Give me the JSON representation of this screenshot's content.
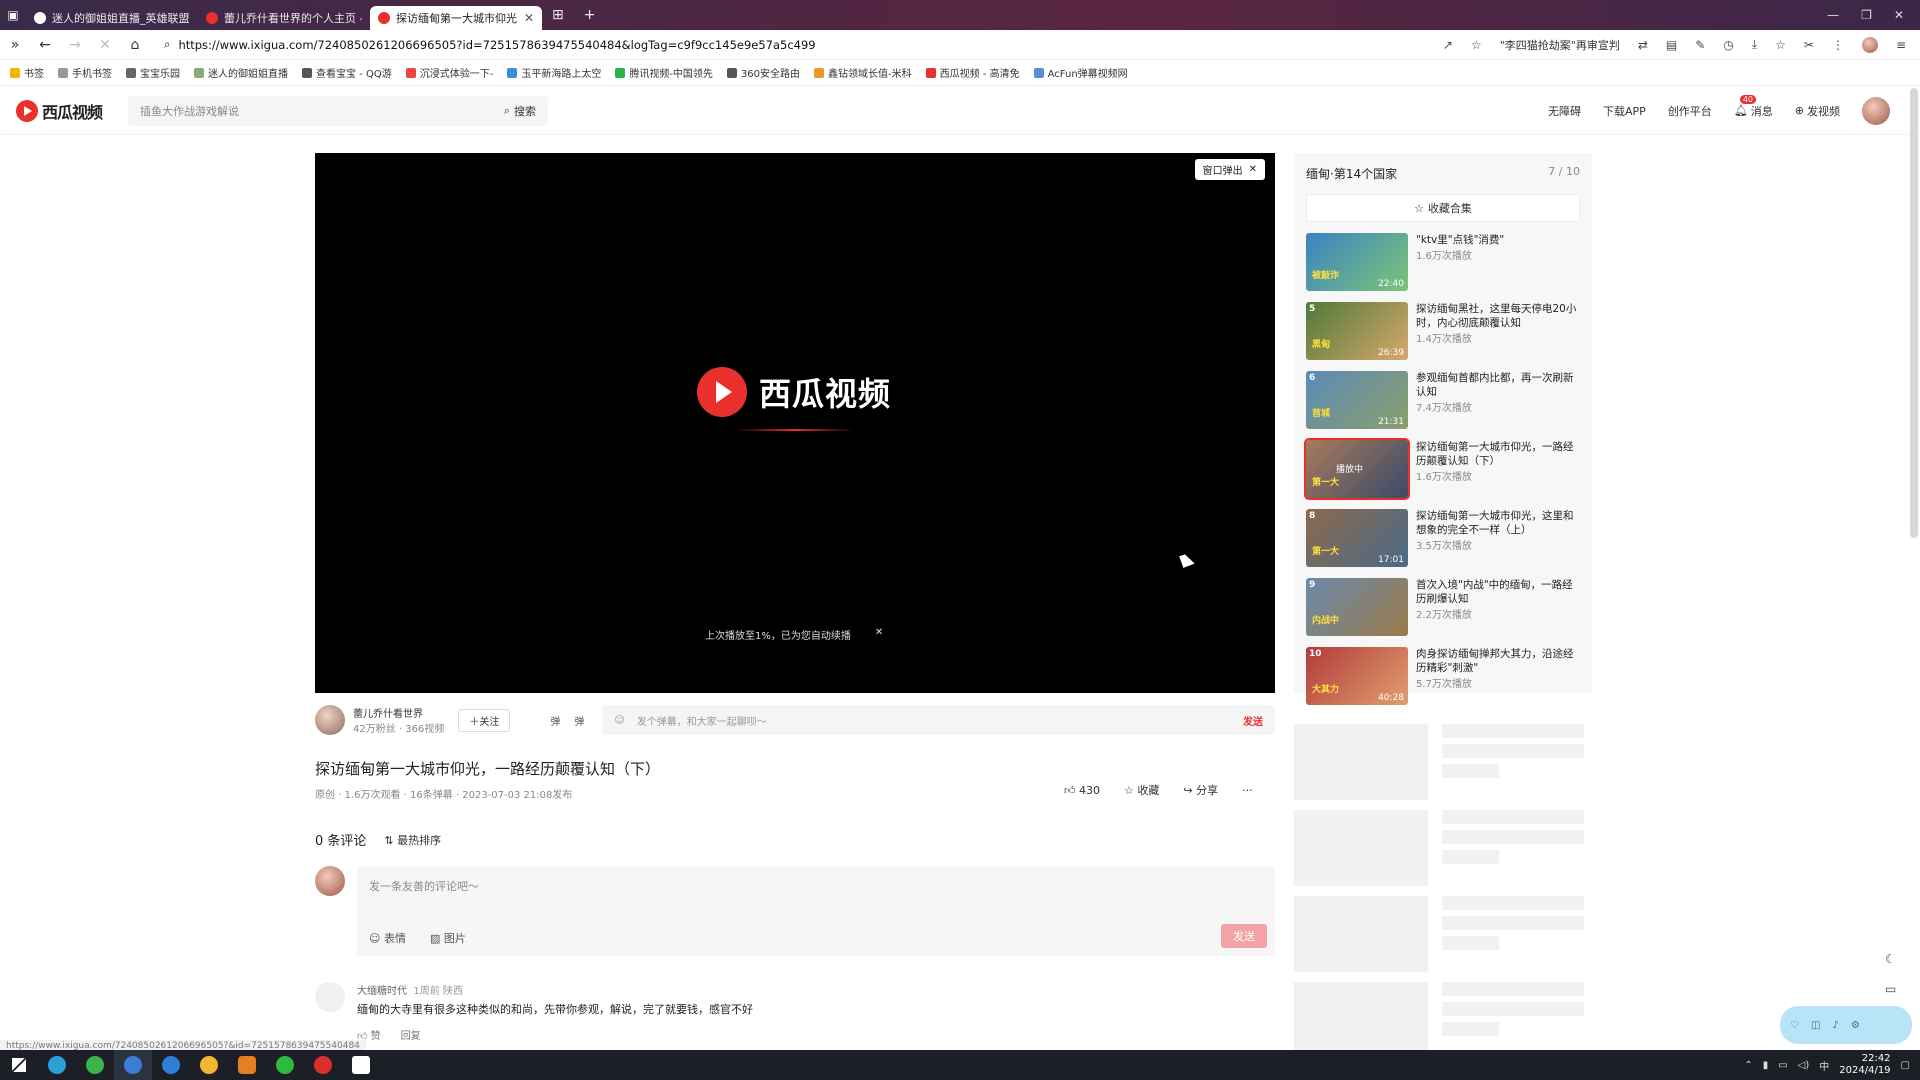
{
  "browser": {
    "tabs": [
      {
        "label": "迷人的御姐姐直播_英雄联盟直播",
        "color": "#ffffff"
      },
      {
        "label": "蕾儿乔什看世界的个人主页 - 西瓜",
        "color": "#e9302d"
      },
      {
        "label": "探访缅甸第一大城市仰光，一路",
        "color": "#e9302d",
        "active": true
      }
    ],
    "url": "https://www.ixigua.com/7240850261206696505?id=7251578639475540484&logTag=c9f9cc145e9e57a5c499",
    "search_hint": "\"李四猫抢劫案\"再审宣判",
    "bookmarks": [
      "书签",
      "手机书签",
      "宝宝乐园",
      "迷人的御姐姐直播",
      "查看宝宝 - QQ游",
      "沉浸式体验一下-",
      "玉平新海路上太空",
      "腾讯视频-中国领先",
      "360安全路由",
      "鑫钻领域长值-米科",
      "西瓜视频 - 高清免",
      "AcFun弹幕视频网"
    ]
  },
  "site": {
    "brand": "西瓜视频",
    "search_placeholder": "插鱼大作战游戏解说",
    "search_btn": "搜索",
    "links": [
      "无障碍",
      "下载APP",
      "创作平台"
    ],
    "notify": {
      "label": "消息",
      "badge": "40"
    },
    "upload": "发视频"
  },
  "player": {
    "popout": "窗口弹出",
    "logo_text": "西瓜视频",
    "resume_tip": "上次播放至1%，已为您自动续播"
  },
  "author": {
    "name": "蕾儿乔什看世界",
    "stats": "42万粉丝 · 366视频",
    "follow": "关注",
    "danmu_placeholder": "发个弹幕，和大家一起聊呗～",
    "send": "发送"
  },
  "video": {
    "title": "探访缅甸第一大城市仰光，一路经历颠覆认知（下）",
    "meta": "原创 · 1.6万次观看 · 16条弹幕 · 2023-07-03 21:08发布",
    "likes": "430",
    "collect": "收藏",
    "share": "分享"
  },
  "comments": {
    "count": "0 条评论",
    "sort": "最热排序",
    "placeholder": "发一条友善的评论吧～",
    "emoji": "表情",
    "image": "图片",
    "send": "发送",
    "items": [
      {
        "user": "大缅糖时代",
        "meta": "1周前 陕西",
        "text": "缅甸的大寺里有很多这种类似的和尚，先带你参观，解说，完了就要钱，感官不好",
        "like": "赞",
        "reply": "回复"
      }
    ]
  },
  "playlist": {
    "title": "缅甸·第14个国家",
    "count": "7 / 10",
    "collect": "收藏合集",
    "items": [
      {
        "num": "",
        "title": "\"ktv里\"点钱\"消费\"",
        "views": "1.6万次播放",
        "dur": "22:40",
        "cap": "被敲诈",
        "bg": "linear-gradient(135deg,#3b82c4,#7cc576)"
      },
      {
        "num": "5",
        "title": "探访缅甸黑社，这里每天停电20小时，内心彻底颠覆认知",
        "views": "1.4万次播放",
        "dur": "26:39",
        "cap": "黑甸",
        "bg": "linear-gradient(135deg,#4f7a3a,#d8a86b)"
      },
      {
        "num": "6",
        "title": "参观缅甸首都内比都，再一次刷新认知",
        "views": "7.4万次播放",
        "dur": "21:31",
        "cap": "首城",
        "bg": "linear-gradient(135deg,#5b8bb8,#8a9f6a)"
      },
      {
        "num": "",
        "title": "探访缅甸第一大城市仰光，一路经历颠覆认知（下）",
        "views": "1.6万次播放",
        "dur": "",
        "cap": "第一大",
        "playing": "播放中",
        "bg": "linear-gradient(135deg,#a87a5a,#3a4a6a)",
        "current": true
      },
      {
        "num": "8",
        "title": "探访缅甸第一大城市仰光，这里和想象的完全不一样（上）",
        "views": "3.5万次播放",
        "dur": "17:01",
        "cap": "第一大",
        "bg": "linear-gradient(135deg,#8b6a4a,#4a6a8a)"
      },
      {
        "num": "9",
        "title": "首次入境\"内战\"中的缅甸，一路经历刷爆认知",
        "views": "2.2万次播放",
        "dur": "",
        "cap": "内战中",
        "bg": "linear-gradient(135deg,#6a8aaa,#9a7a4a)"
      },
      {
        "num": "10",
        "title": "肉身探访缅甸掸邦大其力，沿途经历精彩\"刺激\"",
        "views": "5.7万次播放",
        "dur": "40:28",
        "cap": "大其力",
        "bg": "linear-gradient(135deg,#b33a3a,#e0a070)"
      }
    ]
  },
  "status_url": "https://www.ixigua.com/7240850261206696505?&id=7251578639475540484",
  "clock": {
    "time": "22:42",
    "date": "2024/4/19"
  }
}
